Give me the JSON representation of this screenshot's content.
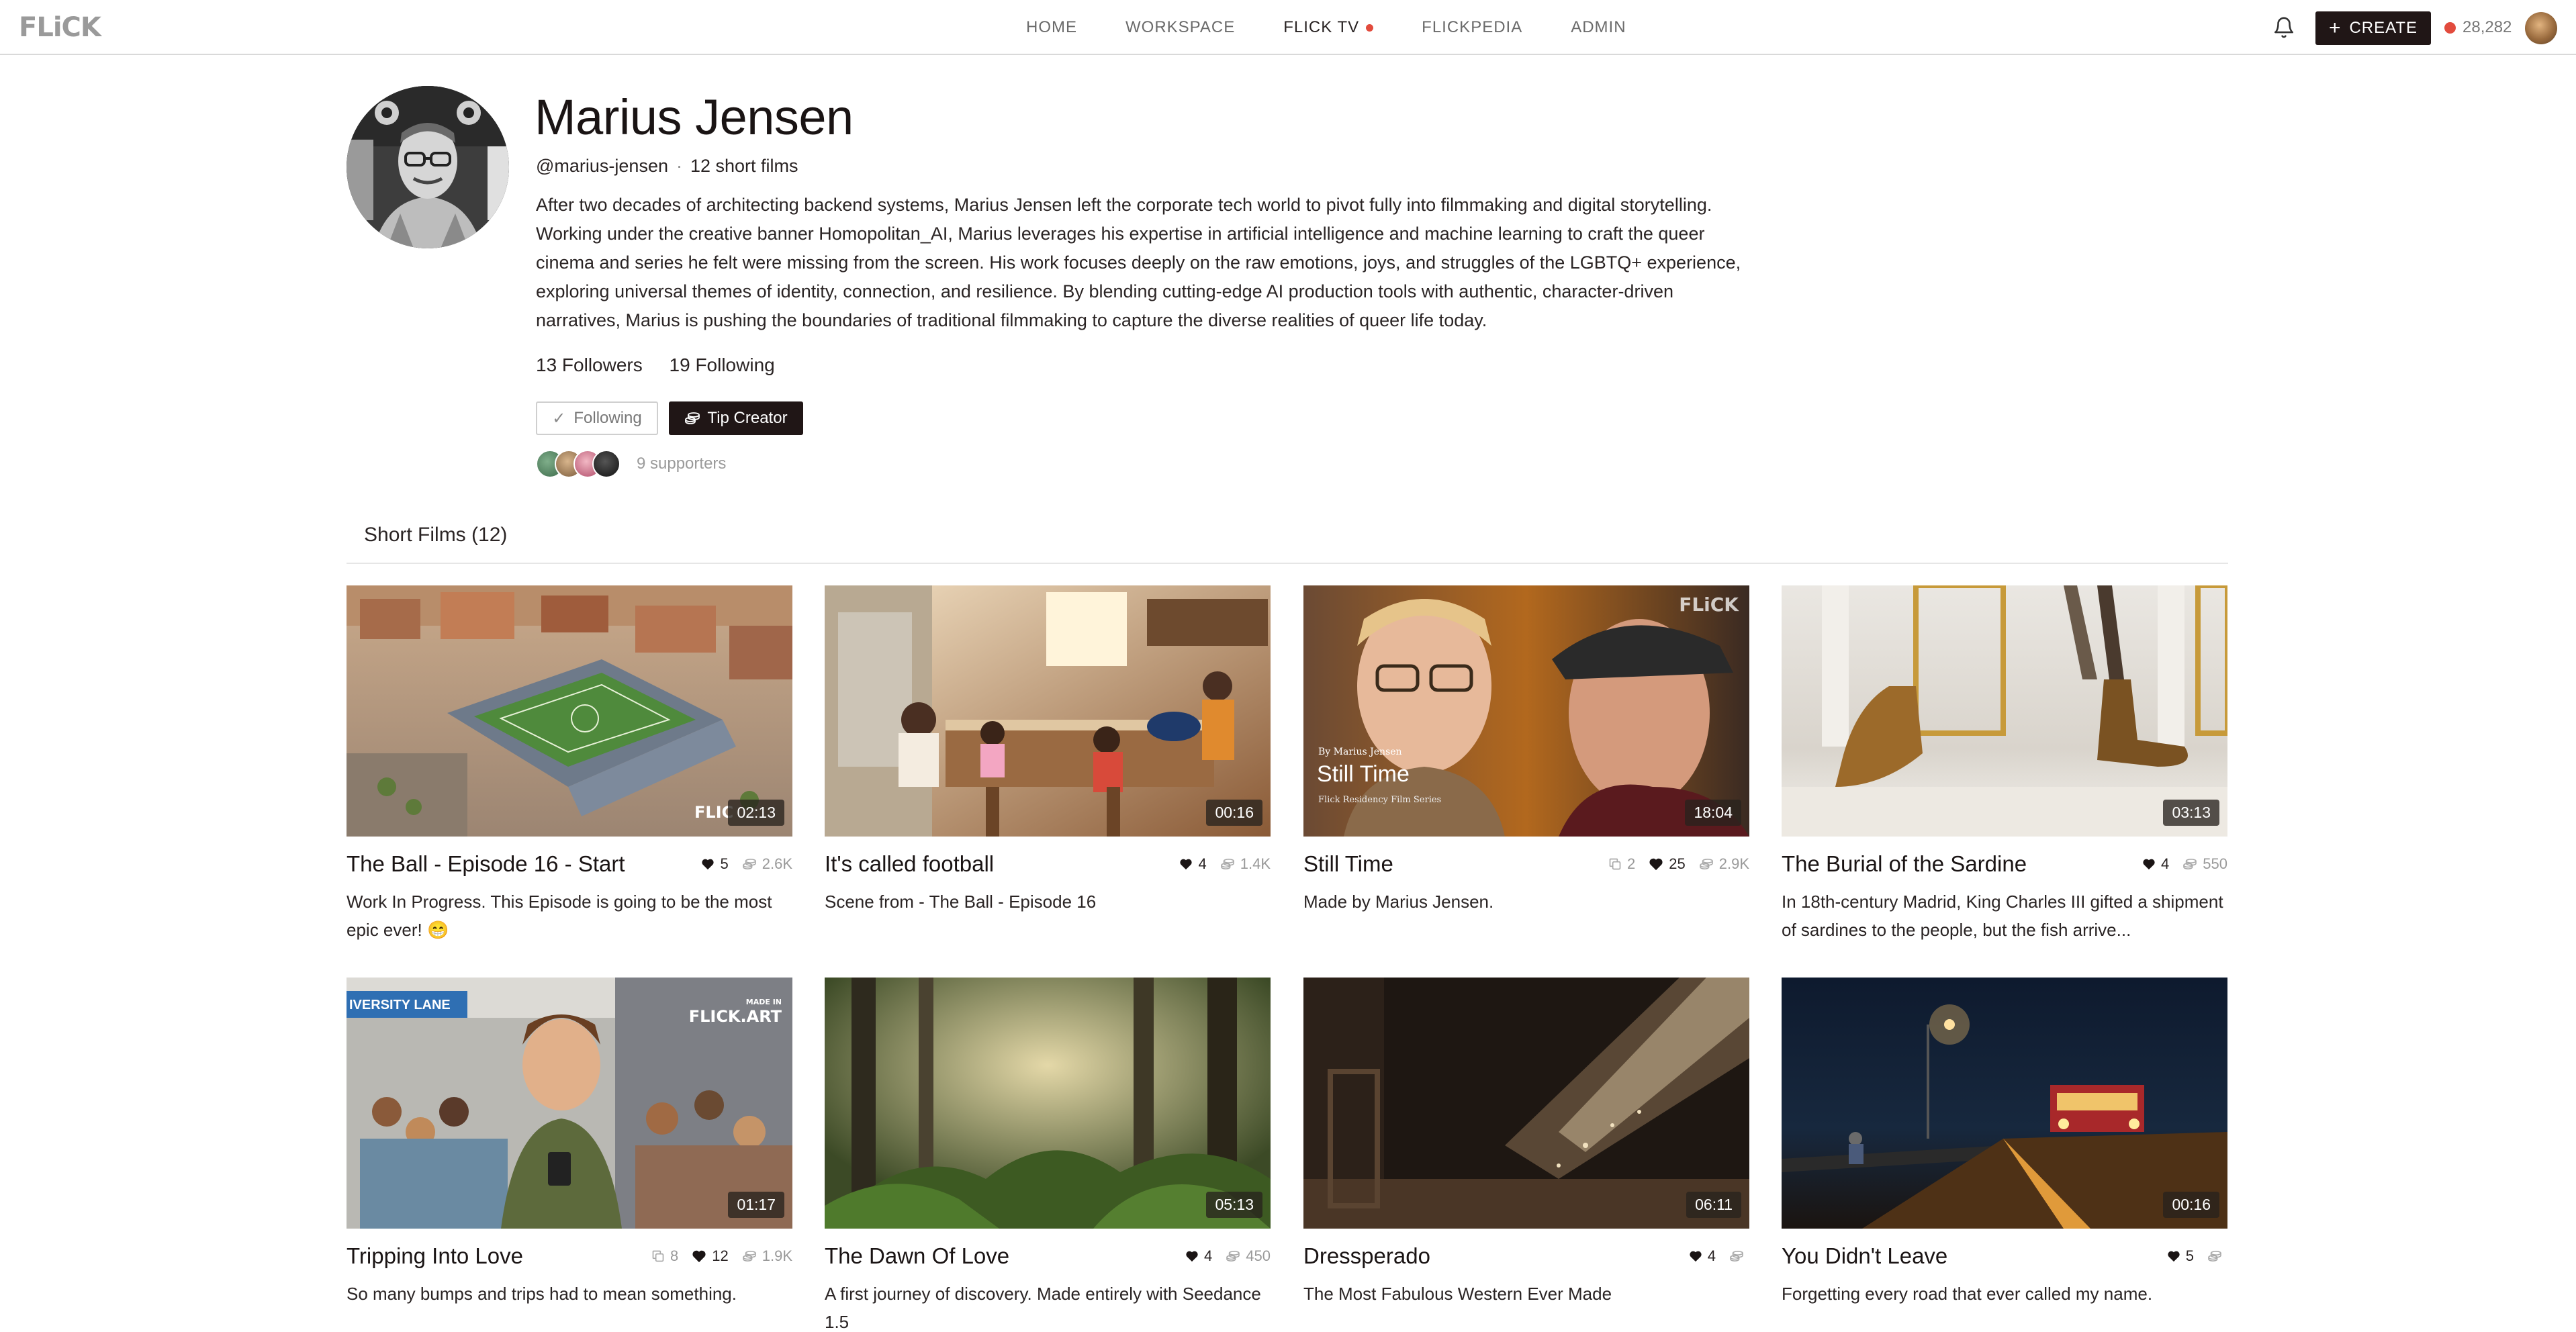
{
  "nav": {
    "logo": "FLiCK",
    "links": [
      {
        "label": "HOME",
        "active": false
      },
      {
        "label": "WORKSPACE",
        "active": false
      },
      {
        "label": "FLICK TV",
        "active": true
      },
      {
        "label": "FLICKPEDIA",
        "active": false
      },
      {
        "label": "ADMIN",
        "active": false
      }
    ],
    "create_label": "CREATE",
    "credits": "28,282",
    "accent_color": "#e24b3d",
    "dark_color": "#201616"
  },
  "profile": {
    "name": "Marius Jensen",
    "handle": "@marius-jensen",
    "film_count": "12 short films",
    "bio": "After two decades of architecting backend systems, Marius Jensen left the corporate tech world to pivot fully into filmmaking and digital storytelling. Working under the creative banner Homopolitan_AI, Marius leverages his expertise in artificial intelligence and machine learning to craft the queer cinema and series he felt were missing from the screen. His work focuses deeply on the raw emotions, joys, and struggles of the LGBTQ+ experience, exploring universal themes of identity, connection, and resilience. By blending cutting-edge AI production tools with authentic, character-driven narratives, Marius is pushing the boundaries of traditional filmmaking to capture the diverse realities of queer life today.",
    "followers": "13 Followers",
    "following": "19 Following",
    "following_button": "Following",
    "tip_button": "Tip Creator",
    "supporters": "9 supporters"
  },
  "section": {
    "title": "Short Films (12)"
  },
  "films": [
    {
      "title": "The Ball - Episode 16 - Start",
      "duration": "02:13",
      "copies": "",
      "likes": "5",
      "views": "2.6K",
      "description": "Work In Progress. This Episode is going to be the most epic ever! 😁",
      "watermark": "FLIC"
    },
    {
      "title": "It's called football",
      "duration": "00:16",
      "copies": "",
      "likes": "4",
      "views": "1.4K",
      "description": "Scene from - The Ball - Episode 16",
      "watermark": ""
    },
    {
      "title": "Still Time",
      "duration": "18:04",
      "copies": "2",
      "likes": "25",
      "views": "2.9K",
      "description": "Made by Marius Jensen.",
      "overlay_by": "By Marius Jensen",
      "overlay_title": "Still Time",
      "overlay_sub": "Flick Residency Film Series",
      "watermark": "FLiCK"
    },
    {
      "title": "The Burial of the Sardine",
      "duration": "03:13",
      "copies": "",
      "likes": "4",
      "views": "550",
      "description": "In 18th-century Madrid, King Charles III gifted a shipment of sardines to the people, but the fish arrive...",
      "watermark": ""
    },
    {
      "title": "Tripping Into Love",
      "duration": "01:17",
      "copies": "8",
      "likes": "12",
      "views": "1.9K",
      "description": "So many bumps and trips had to mean something.",
      "sign": "IVERSITY LANE",
      "wm_small": "MADE IN",
      "wm_big": "FLICK.ART"
    },
    {
      "title": "The Dawn Of Love",
      "duration": "05:13",
      "copies": "",
      "likes": "4",
      "views": "450",
      "description": "A first journey of discovery. Made entirely with Seedance 1.5",
      "watermark": ""
    },
    {
      "title": "Dressperado",
      "duration": "06:11",
      "copies": "",
      "likes": "4",
      "views": "",
      "description": "The Most Fabulous Western Ever Made",
      "watermark": ""
    },
    {
      "title": "You Didn't Leave",
      "duration": "00:16",
      "copies": "",
      "likes": "5",
      "views": "",
      "description": "Forgetting every road that ever called my name.",
      "watermark": ""
    }
  ]
}
